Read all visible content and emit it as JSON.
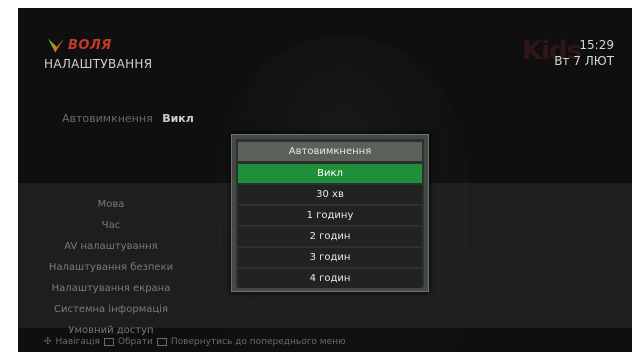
{
  "brand": {
    "logo_text": "ВОЛЯ",
    "channel_watermark": "Kids"
  },
  "header": {
    "title": "НАЛАШТУВАННЯ",
    "time": "15:29",
    "date": "Вт 7 ЛЮТ"
  },
  "current_setting": {
    "label": "Автовимкнення",
    "value": "Викл"
  },
  "menu": {
    "items": [
      "Мова",
      "Час",
      "AV налаштування",
      "Налаштування безпеки",
      "Налаштування екрана",
      "Системна інформація",
      "Умовний доступ"
    ]
  },
  "footer": {
    "nav_label": "Навігація",
    "select_label": "Обрати",
    "back_label": "Повернутись до попереднього меню"
  },
  "dialog": {
    "title": "Автовимкнення",
    "options": [
      "Викл",
      "30 хв",
      "1 годину",
      "2 годин",
      "3 годин",
      "4 годин"
    ],
    "selected_index": 0
  },
  "colors": {
    "selected": "#1f8f3a",
    "background": "#0f0f0f",
    "brand_red": "#c43a2a",
    "brand_green": "#79b12b"
  }
}
